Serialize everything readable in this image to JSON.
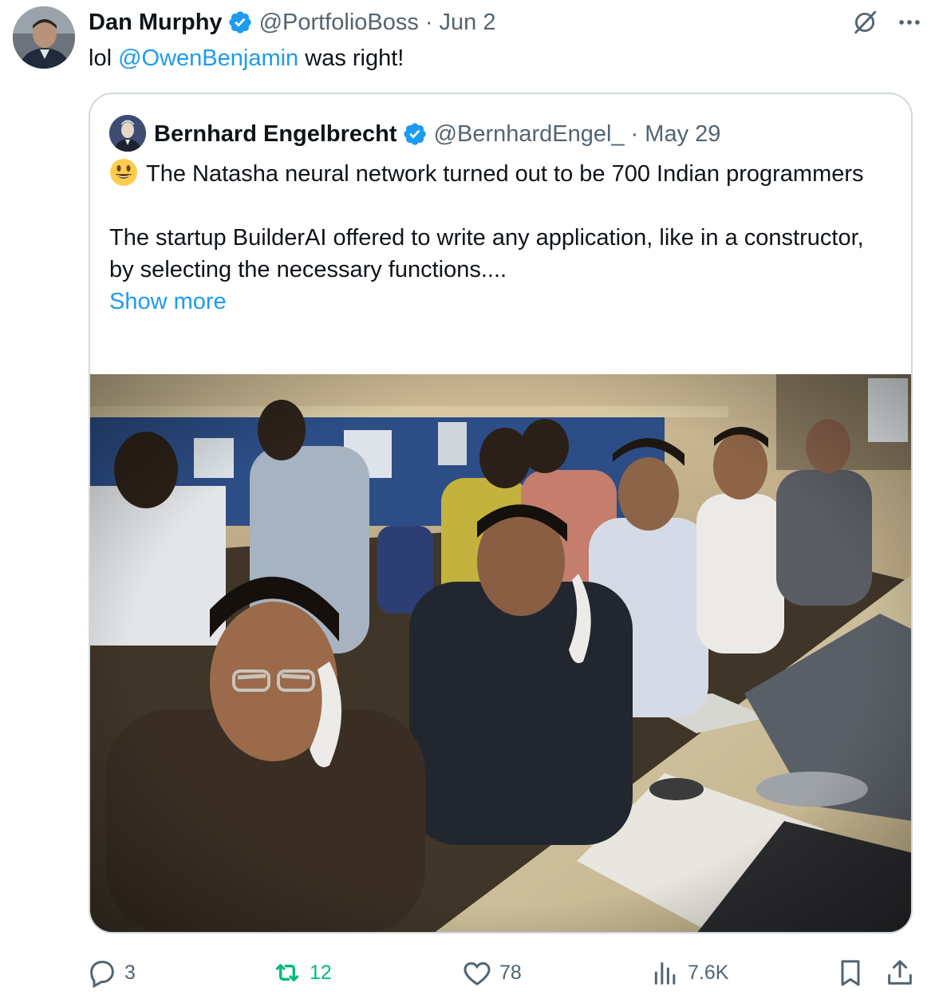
{
  "author": {
    "name": "Dan Murphy",
    "handle": "@PortfolioBoss",
    "separator": "·",
    "date": "Jun 2"
  },
  "tweet": {
    "prefix": "lol ",
    "mention": "@OwenBenjamin",
    "suffix": " was right!"
  },
  "quoted": {
    "name": "Bernhard Engelbrecht",
    "handle": "@BernhardEngel_",
    "separator": "·",
    "date": "May 29",
    "emoji": "smiling-face-emoji",
    "line1": "The Natasha neural network turned out to be 700 Indian programmers",
    "line2": "The startup BuilderAI offered to write any application, like in a constructor, by selecting the necessary functions....",
    "show_more": "Show more"
  },
  "actions": {
    "replies": "3",
    "reposts": "12",
    "likes": "78",
    "views": "7.6K"
  },
  "colors": {
    "accent": "#1d9bf0",
    "muted": "#536471",
    "repost": "#00ba7c",
    "border": "#cfd9de"
  }
}
